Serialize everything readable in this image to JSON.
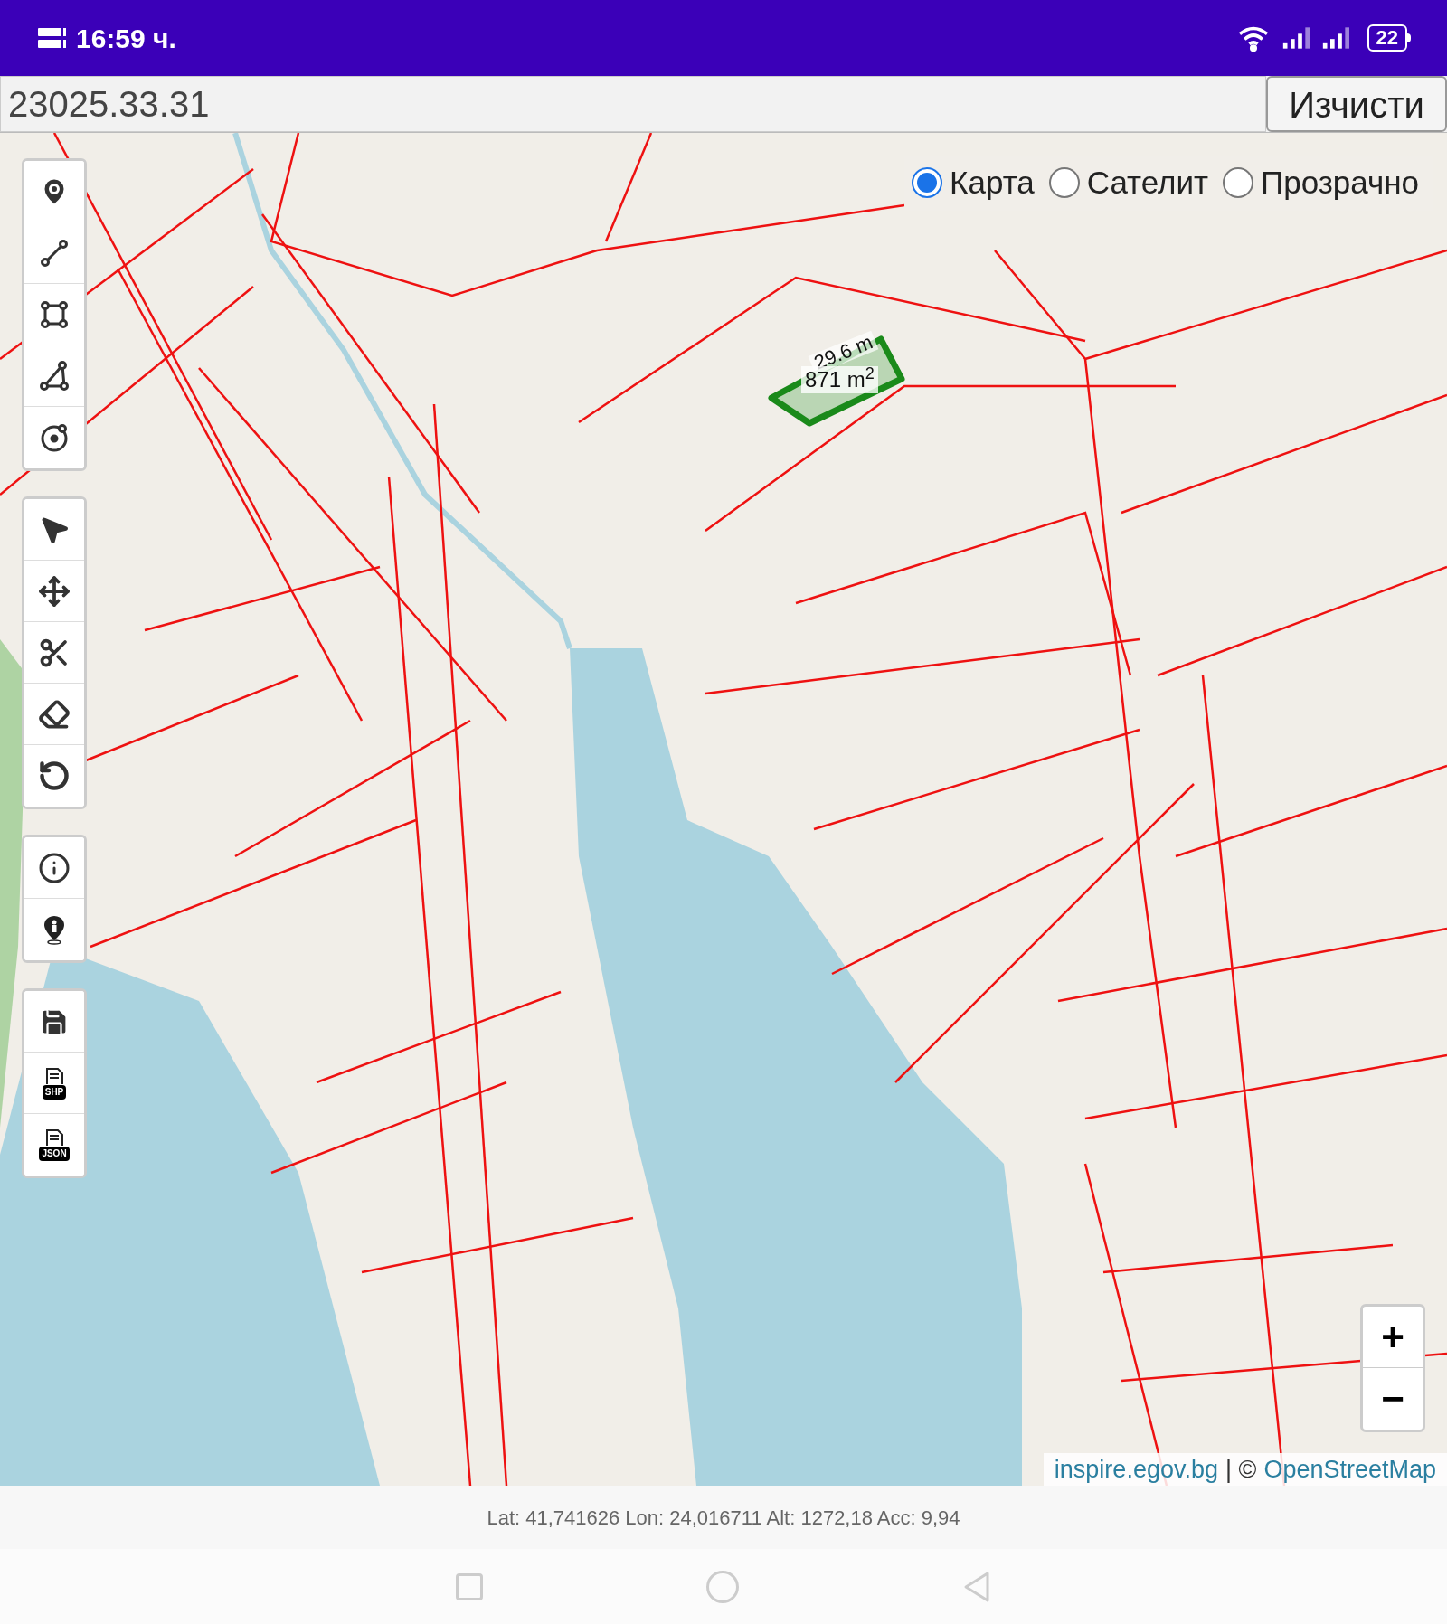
{
  "status_bar": {
    "time": "16:59 ч.",
    "battery": "22"
  },
  "search": {
    "value": "23025.33.31",
    "clear_button": "Изчисти"
  },
  "layers": [
    {
      "label": "Карта",
      "selected": true
    },
    {
      "label": "Сателит",
      "selected": false
    },
    {
      "label": "Прозрачно",
      "selected": false
    }
  ],
  "toolbar_groups": [
    [
      {
        "kind": "marker"
      },
      {
        "kind": "line"
      },
      {
        "kind": "polygon"
      },
      {
        "kind": "angle"
      },
      {
        "kind": "circle"
      }
    ],
    [
      {
        "kind": "select"
      },
      {
        "kind": "move"
      },
      {
        "kind": "cut"
      },
      {
        "kind": "erase"
      },
      {
        "kind": "undo"
      }
    ],
    [
      {
        "kind": "info"
      },
      {
        "kind": "locate"
      }
    ],
    [
      {
        "kind": "save"
      },
      {
        "kind": "file",
        "label": "SHP"
      },
      {
        "kind": "file",
        "label": "JSON"
      }
    ]
  ],
  "measurement": {
    "length": "29.6 m",
    "area": "871 m$^{2}$"
  },
  "zoom": {
    "zoom_in": "+",
    "zoom_out": "−"
  },
  "attribution": {
    "source": "inspire.egov.bg",
    "separator": "| ©",
    "osm": "OpenStreetMap"
  },
  "location": "Lat: 41,741626 Lon: 24,016711 Alt: 1272,18 Acc: 9,94"
}
